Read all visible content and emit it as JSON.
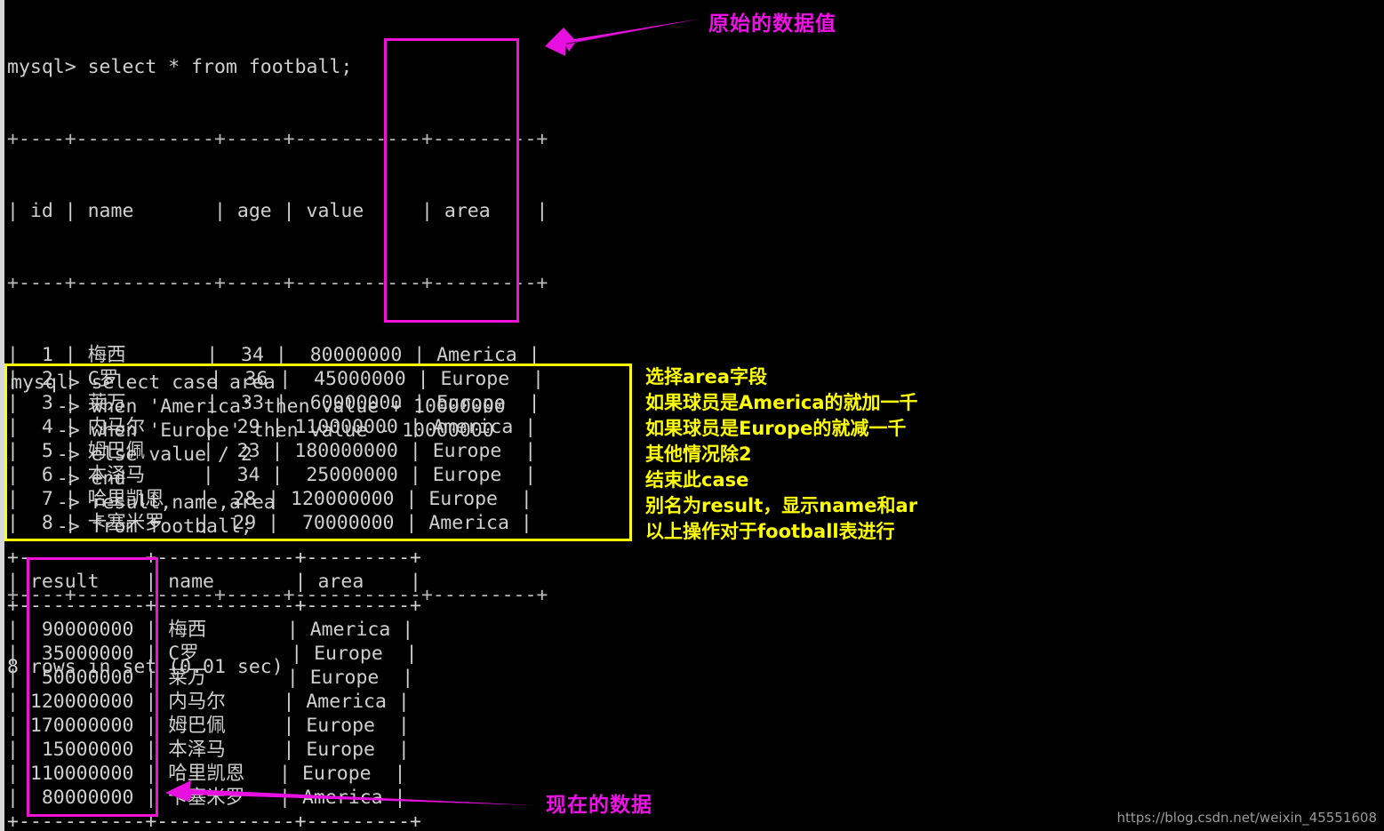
{
  "terminal": {
    "prompt_line": "mysql> select * from football;",
    "table1": {
      "sep_line": "+----+------------+-----+-----------+---------+",
      "header": "| id | name       | age | value     | area    |",
      "columns": [
        "id",
        "name",
        "age",
        "value",
        "area"
      ],
      "rows": [
        {
          "id": "1",
          "name": "梅西",
          "age": "34",
          "value": "80000000",
          "area": "America"
        },
        {
          "id": "2",
          "name": "C罗",
          "age": "36",
          "value": "45000000",
          "area": "Europe"
        },
        {
          "id": "3",
          "name": "莱万",
          "age": "33",
          "value": "60000000",
          "area": "Europe"
        },
        {
          "id": "4",
          "name": "内马尔",
          "age": "29",
          "value": "110000000",
          "area": "America"
        },
        {
          "id": "5",
          "name": "姆巴佩",
          "age": "23",
          "value": "180000000",
          "area": "Europe"
        },
        {
          "id": "6",
          "name": "本泽马",
          "age": "34",
          "value": "25000000",
          "area": "Europe"
        },
        {
          "id": "7",
          "name": "哈里凯恩",
          "age": "28",
          "value": "120000000",
          "area": "Europe"
        },
        {
          "id": "8",
          "name": "卡塞米罗",
          "age": "29",
          "value": "70000000",
          "area": "America"
        }
      ],
      "footer": "8 rows in set (0.01 sec)"
    },
    "query": {
      "lines": [
        "mysql> select case area",
        "    -> when 'America' then value + 10000000",
        "    -> when 'Europe' then value - 10000000",
        "    -> else value / 2",
        "    -> end",
        "    -> result,name,area",
        "    -> from football;"
      ]
    },
    "table2": {
      "columns": [
        "result",
        "name",
        "area"
      ],
      "rows": [
        {
          "result": "90000000",
          "name": "梅西",
          "area": "America"
        },
        {
          "result": "35000000",
          "name": "C罗",
          "area": "Europe"
        },
        {
          "result": "50000000",
          "name": "莱万",
          "area": "Europe"
        },
        {
          "result": "120000000",
          "name": "内马尔",
          "area": "America"
        },
        {
          "result": "170000000",
          "name": "姆巴佩",
          "area": "Europe"
        },
        {
          "result": "15000000",
          "name": "本泽马",
          "area": "Europe"
        },
        {
          "result": "110000000",
          "name": "哈里凯恩",
          "area": "Europe"
        },
        {
          "result": "80000000",
          "name": "卡塞米罗",
          "area": "America"
        }
      ]
    }
  },
  "annotations": {
    "original_values": "原始的数据值",
    "current_values": "现在的数据",
    "explain_lines": [
      "选择area字段",
      "如果球员是America的就加一千",
      "如果球员是Europe的就减一千",
      "其他情况除2",
      "结束此case",
      "别名为result，显示name和ar",
      "以上操作对于football表进行"
    ]
  },
  "watermark": {
    "text": "https://blog.csdn.net/weixin_45551608"
  },
  "colors": {
    "background": "#000000",
    "terminal_text": "#cfcfcf",
    "highlight_magenta": "#f012d6",
    "highlight_yellow": "#ffff00",
    "annotation_magenta": "#f010e8"
  },
  "derived": {
    "table1_text": "",
    "table2_text": ""
  }
}
